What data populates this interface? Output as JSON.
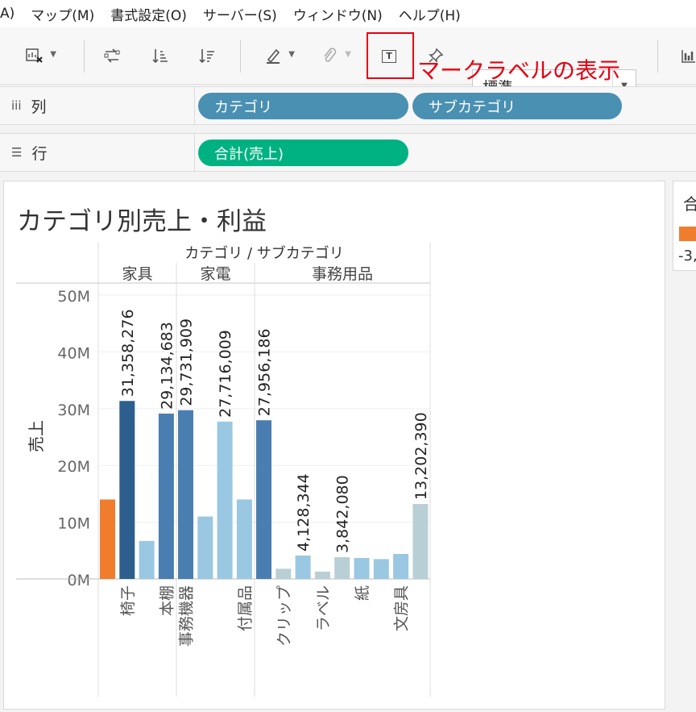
{
  "menu": [
    "A)",
    "マップ(M)",
    "書式設定(O)",
    "サーバー(S)",
    "ウィンドウ(N)",
    "ヘルプ(H)"
  ],
  "toolbar": {
    "mark_size_value": "標準",
    "annotation": "マークラベルの表示",
    "highlight_color": "#e60012"
  },
  "columns_shelf": {
    "label": "列",
    "icon": "columns-icon",
    "pills": [
      "カテゴリ",
      "サブカテゴリ"
    ]
  },
  "rows_shelf": {
    "label": "行",
    "icon": "rows-icon",
    "pills": [
      "合計(売上)"
    ]
  },
  "viz": {
    "title": "カテゴリ別売上・利益"
  },
  "legend": {
    "title": "合",
    "value": "-3,"
  },
  "chart_data": {
    "type": "bar",
    "title": "カテゴリ別売上・利益",
    "header_title": "カテゴリ / サブカテゴリ",
    "ylabel": "売上",
    "ylim": [
      0,
      50000000
    ],
    "yticks": [
      "0M",
      "10M",
      "20M",
      "30M",
      "40M",
      "50M"
    ],
    "groups": [
      {
        "name": "家具",
        "bars": [
          {
            "label": "",
            "value": 14000000,
            "color": "#ef7d2d",
            "data_label": ""
          },
          {
            "label": "椅子",
            "value": 31358276,
            "color": "#2c5f8e",
            "data_label": "31,358,276"
          },
          {
            "label": "",
            "value": 6700000,
            "color": "#9ac8e2",
            "data_label": ""
          },
          {
            "label": "本棚",
            "value": 29134683,
            "color": "#4a7eb0",
            "data_label": "29,134,683"
          }
        ]
      },
      {
        "name": "家電",
        "bars": [
          {
            "label": "事務機器",
            "value": 29731909,
            "color": "#4a7eb0",
            "data_label": "29,731,909"
          },
          {
            "label": "",
            "value": 11000000,
            "color": "#9ac8e2",
            "data_label": ""
          },
          {
            "label": "",
            "value": 27716009,
            "color": "#9ac8e2",
            "data_label": "27,716,009"
          },
          {
            "label": "付属品",
            "value": 14000000,
            "color": "#9ac8e2",
            "data_label": ""
          }
        ]
      },
      {
        "name": "事務用品",
        "bars": [
          {
            "label": "",
            "value": 27956186,
            "color": "#4a7eb0",
            "data_label": "27,956,186"
          },
          {
            "label": "クリップ",
            "value": 1800000,
            "color": "#b9cfd6",
            "data_label": ""
          },
          {
            "label": "",
            "value": 4128344,
            "color": "#9ac8e2",
            "data_label": "4,128,344"
          },
          {
            "label": "ラベル",
            "value": 1300000,
            "color": "#b9cfd6",
            "data_label": ""
          },
          {
            "label": "",
            "value": 3842080,
            "color": "#b9cfd6",
            "data_label": "3,842,080"
          },
          {
            "label": "紙",
            "value": 3700000,
            "color": "#9ac8e2",
            "data_label": ""
          },
          {
            "label": "",
            "value": 3500000,
            "color": "#9ac8e2",
            "data_label": ""
          },
          {
            "label": "文房具",
            "value": 4400000,
            "color": "#9ac8e2",
            "data_label": ""
          },
          {
            "label": "",
            "value": 13202390,
            "color": "#b9cfd6",
            "data_label": "13,202,390"
          }
        ]
      }
    ]
  }
}
